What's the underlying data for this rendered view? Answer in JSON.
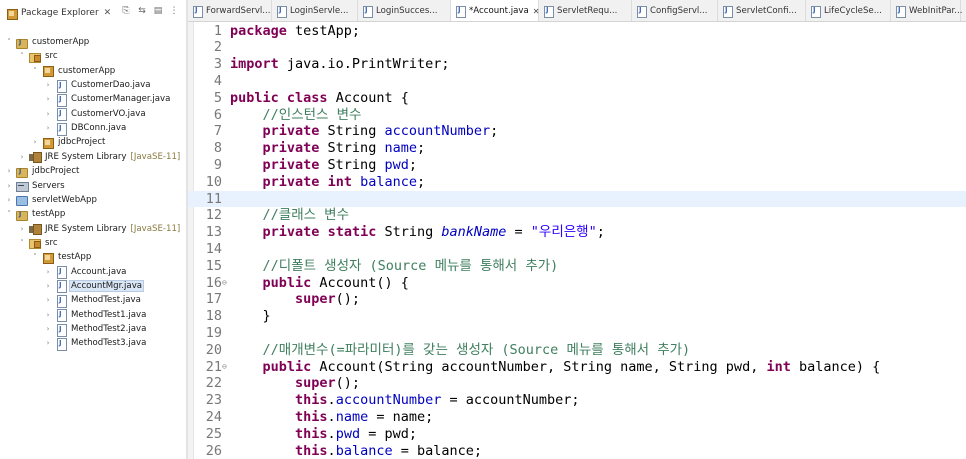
{
  "explorer": {
    "title": "Package Explorer",
    "close_glyph": "✕",
    "tools": [
      "⎘",
      "⇆",
      "▤",
      "⋮"
    ],
    "tree": [
      {
        "indent": 0,
        "twisty": "˅",
        "icon": "project",
        "label": "customerApp"
      },
      {
        "indent": 1,
        "twisty": "˅",
        "icon": "src",
        "label": "src"
      },
      {
        "indent": 2,
        "twisty": "˅",
        "icon": "pkg",
        "label": "customerApp"
      },
      {
        "indent": 3,
        "twisty": "›",
        "icon": "file",
        "label": "CustomerDao.java"
      },
      {
        "indent": 3,
        "twisty": "›",
        "icon": "file",
        "label": "CustomerManager.java"
      },
      {
        "indent": 3,
        "twisty": "›",
        "icon": "file",
        "label": "CustomerVO.java"
      },
      {
        "indent": 3,
        "twisty": "›",
        "icon": "file",
        "label": "DBConn.java"
      },
      {
        "indent": 2,
        "twisty": "›",
        "icon": "pkg",
        "label": "jdbcProject"
      },
      {
        "indent": 1,
        "twisty": "›",
        "icon": "lib",
        "label": "JRE System Library",
        "deco": "[JavaSE-11]"
      },
      {
        "indent": 0,
        "twisty": "›",
        "icon": "project",
        "label": "jdbcProject"
      },
      {
        "indent": 0,
        "twisty": "›",
        "icon": "servers",
        "label": "Servers"
      },
      {
        "indent": 0,
        "twisty": "›",
        "icon": "web",
        "label": "servletWebApp"
      },
      {
        "indent": 0,
        "twisty": "˅",
        "icon": "project",
        "label": "testApp"
      },
      {
        "indent": 1,
        "twisty": "›",
        "icon": "lib",
        "label": "JRE System Library",
        "deco": "[JavaSE-11]"
      },
      {
        "indent": 1,
        "twisty": "˅",
        "icon": "src",
        "label": "src"
      },
      {
        "indent": 2,
        "twisty": "˅",
        "icon": "pkg",
        "label": "testApp"
      },
      {
        "indent": 3,
        "twisty": "›",
        "icon": "file",
        "label": "Account.java"
      },
      {
        "indent": 3,
        "twisty": "›",
        "icon": "file",
        "label": "AccountMgr.java",
        "selected": true
      },
      {
        "indent": 3,
        "twisty": "›",
        "icon": "file",
        "label": "MethodTest.java"
      },
      {
        "indent": 3,
        "twisty": "›",
        "icon": "file",
        "label": "MethodTest1.java"
      },
      {
        "indent": 3,
        "twisty": "›",
        "icon": "file",
        "label": "MethodTest2.java"
      },
      {
        "indent": 3,
        "twisty": "›",
        "icon": "file",
        "label": "MethodTest3.java"
      }
    ]
  },
  "tabs": [
    {
      "label": "ForwardServl..."
    },
    {
      "label": "LoginServle..."
    },
    {
      "label": "LoginSucces..."
    },
    {
      "label": "*Account.java",
      "active": true,
      "close": "✕"
    },
    {
      "label": "ServletRequ..."
    },
    {
      "label": "ConfigServl..."
    },
    {
      "label": "ServletConfi..."
    },
    {
      "label": "LifeCycleSe..."
    },
    {
      "label": "WebInitPar..."
    }
  ],
  "editor": {
    "current_line": 11,
    "lines": [
      {
        "n": "1",
        "tokens": [
          {
            "t": "package",
            "c": "kw"
          },
          {
            "t": " testApp;"
          }
        ]
      },
      {
        "n": "2",
        "tokens": []
      },
      {
        "n": "3",
        "tokens": [
          {
            "t": "import",
            "c": "kw"
          },
          {
            "t": " java.io.PrintWriter;"
          }
        ]
      },
      {
        "n": "4",
        "tokens": []
      },
      {
        "n": "5",
        "tokens": [
          {
            "t": "public",
            "c": "kw"
          },
          {
            "t": " "
          },
          {
            "t": "class",
            "c": "kw"
          },
          {
            "t": " Account {"
          }
        ]
      },
      {
        "n": "6",
        "tokens": [
          {
            "t": "    "
          },
          {
            "t": "//인스턴스 변수",
            "c": "cm"
          }
        ]
      },
      {
        "n": "7",
        "tokens": [
          {
            "t": "    "
          },
          {
            "t": "private",
            "c": "kw"
          },
          {
            "t": " String "
          },
          {
            "t": "accountNumber",
            "c": "fld"
          },
          {
            "t": ";"
          }
        ]
      },
      {
        "n": "8",
        "tokens": [
          {
            "t": "    "
          },
          {
            "t": "private",
            "c": "kw"
          },
          {
            "t": " String "
          },
          {
            "t": "name",
            "c": "fld"
          },
          {
            "t": ";"
          }
        ]
      },
      {
        "n": "9",
        "tokens": [
          {
            "t": "    "
          },
          {
            "t": "private",
            "c": "kw"
          },
          {
            "t": " String "
          },
          {
            "t": "pwd",
            "c": "fld"
          },
          {
            "t": ";"
          }
        ]
      },
      {
        "n": "10",
        "tokens": [
          {
            "t": "    "
          },
          {
            "t": "private",
            "c": "kw"
          },
          {
            "t": " "
          },
          {
            "t": "int",
            "c": "kw"
          },
          {
            "t": " "
          },
          {
            "t": "balance",
            "c": "fld"
          },
          {
            "t": ";"
          }
        ]
      },
      {
        "n": "11",
        "tokens": []
      },
      {
        "n": "12",
        "tokens": [
          {
            "t": "    "
          },
          {
            "t": "//클래스 변수",
            "c": "cm"
          }
        ]
      },
      {
        "n": "13",
        "tokens": [
          {
            "t": "    "
          },
          {
            "t": "private",
            "c": "kw"
          },
          {
            "t": " "
          },
          {
            "t": "static",
            "c": "kw"
          },
          {
            "t": " String "
          },
          {
            "t": "bankName",
            "c": "sfld"
          },
          {
            "t": " = "
          },
          {
            "t": "\"우리은행\"",
            "c": "str"
          },
          {
            "t": ";"
          }
        ]
      },
      {
        "n": "14",
        "tokens": []
      },
      {
        "n": "15",
        "tokens": [
          {
            "t": "    "
          },
          {
            "t": "//디폴트 생성자 (Source 메뉴를 통해서 추가)",
            "c": "cm"
          }
        ]
      },
      {
        "n": "16",
        "fold": "⊖",
        "tokens": [
          {
            "t": "    "
          },
          {
            "t": "public",
            "c": "kw"
          },
          {
            "t": " Account() {"
          }
        ]
      },
      {
        "n": "17",
        "tokens": [
          {
            "t": "        "
          },
          {
            "t": "super",
            "c": "kw"
          },
          {
            "t": "();"
          }
        ]
      },
      {
        "n": "18",
        "tokens": [
          {
            "t": "    }"
          }
        ]
      },
      {
        "n": "19",
        "tokens": []
      },
      {
        "n": "20",
        "tokens": [
          {
            "t": "    "
          },
          {
            "t": "//매개변수(=파라미터)를 갖는 생성자 (Source 메뉴를 통해서 추가)",
            "c": "cm"
          }
        ]
      },
      {
        "n": "21",
        "fold": "⊖",
        "tokens": [
          {
            "t": "    "
          },
          {
            "t": "public",
            "c": "kw"
          },
          {
            "t": " Account(String accountNumber, String name, String pwd, "
          },
          {
            "t": "int",
            "c": "kw"
          },
          {
            "t": " balance) {"
          }
        ]
      },
      {
        "n": "22",
        "tokens": [
          {
            "t": "        "
          },
          {
            "t": "super",
            "c": "kw"
          },
          {
            "t": "();"
          }
        ]
      },
      {
        "n": "23",
        "tokens": [
          {
            "t": "        "
          },
          {
            "t": "this",
            "c": "kw"
          },
          {
            "t": "."
          },
          {
            "t": "accountNumber",
            "c": "fld"
          },
          {
            "t": " = accountNumber;"
          }
        ]
      },
      {
        "n": "24",
        "tokens": [
          {
            "t": "        "
          },
          {
            "t": "this",
            "c": "kw"
          },
          {
            "t": "."
          },
          {
            "t": "name",
            "c": "fld"
          },
          {
            "t": " = name;"
          }
        ]
      },
      {
        "n": "25",
        "tokens": [
          {
            "t": "        "
          },
          {
            "t": "this",
            "c": "kw"
          },
          {
            "t": "."
          },
          {
            "t": "pwd",
            "c": "fld"
          },
          {
            "t": " = pwd;"
          }
        ]
      },
      {
        "n": "26",
        "tokens": [
          {
            "t": "        "
          },
          {
            "t": "this",
            "c": "kw"
          },
          {
            "t": "."
          },
          {
            "t": "balance",
            "c": "fld"
          },
          {
            "t": " = balance;"
          }
        ]
      }
    ]
  }
}
